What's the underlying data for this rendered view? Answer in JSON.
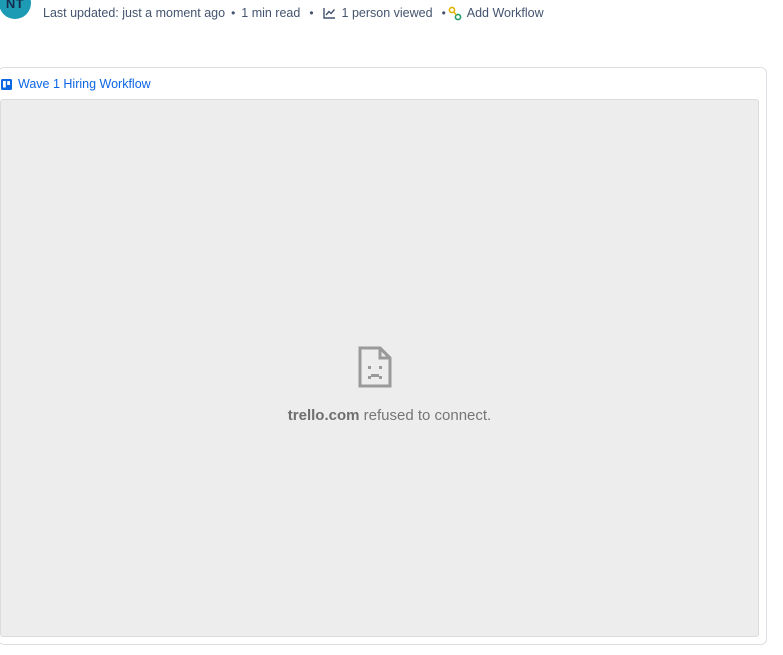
{
  "author": {
    "initials": "NT"
  },
  "meta": {
    "last_updated": "Last updated: just a moment ago",
    "read_time": "1 min read",
    "views": "1 person viewed",
    "add_workflow": "Add Workflow",
    "separator": "•"
  },
  "embed": {
    "title": "Wave 1 Hiring Workflow",
    "error_domain": "trello.com",
    "error_text": " refused to connect."
  },
  "colors": {
    "avatar": "#1d9bb5",
    "link": "#0c66e4",
    "frame_bg": "#ededed",
    "text_muted": "#44546f"
  },
  "icons": {
    "views": "line-chart-icon",
    "workflow": "workflow-icon",
    "embed": "trello-icon",
    "error": "sad-page-icon"
  }
}
